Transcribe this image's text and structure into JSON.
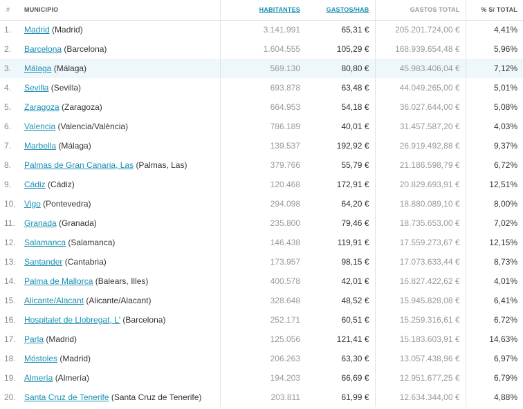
{
  "headers": {
    "num": "#",
    "municipio": "MUNICIPIO",
    "habitantes": "HABITANTES",
    "gastos_hab": "GASTOS/HAB",
    "gastos_total": "GASTOS TOTAL",
    "pct_total": "% S/ TOTAL"
  },
  "highlight_color": "#eef7f9",
  "link_color": "#1a8fb3",
  "rows": [
    {
      "num": "1.",
      "name": "Madrid",
      "province": "(Madrid)",
      "habitantes": "3.141.991",
      "gastos_hab": "65,31 €",
      "gastos_total": "205.201.724,00 €",
      "pct": "4,41%"
    },
    {
      "num": "2.",
      "name": "Barcelona",
      "province": "(Barcelona)",
      "habitantes": "1.604.555",
      "gastos_hab": "105,29 €",
      "gastos_total": "168.939.654,48 €",
      "pct": "5,96%"
    },
    {
      "num": "3.",
      "name": "Málaga",
      "province": "(Málaga)",
      "habitantes": "569.130",
      "gastos_hab": "80,80 €",
      "gastos_total": "45.983.406,04 €",
      "pct": "7,12%"
    },
    {
      "num": "4.",
      "name": "Sevilla",
      "province": "(Sevilla)",
      "habitantes": "693.878",
      "gastos_hab": "63,48 €",
      "gastos_total": "44.049.265,00 €",
      "pct": "5,01%"
    },
    {
      "num": "5.",
      "name": "Zaragoza",
      "province": "(Zaragoza)",
      "habitantes": "664.953",
      "gastos_hab": "54,18 €",
      "gastos_total": "36.027.644,00 €",
      "pct": "5,08%"
    },
    {
      "num": "6.",
      "name": "Valencia",
      "province": "(Valencia/València)",
      "habitantes": "786.189",
      "gastos_hab": "40,01 €",
      "gastos_total": "31.457.587,20 €",
      "pct": "4,03%"
    },
    {
      "num": "7.",
      "name": "Marbella",
      "province": "(Málaga)",
      "habitantes": "139.537",
      "gastos_hab": "192,92 €",
      "gastos_total": "26.919.492,88 €",
      "pct": "9,37%"
    },
    {
      "num": "8.",
      "name": "Palmas de Gran Canaria, Las",
      "province": "(Palmas, Las)",
      "habitantes": "379.766",
      "gastos_hab": "55,79 €",
      "gastos_total": "21.186.598,79 €",
      "pct": "6,72%"
    },
    {
      "num": "9.",
      "name": "Cádiz",
      "province": "(Cádiz)",
      "habitantes": "120.468",
      "gastos_hab": "172,91 €",
      "gastos_total": "20.829.693,91 €",
      "pct": "12,51%"
    },
    {
      "num": "10.",
      "name": "Vigo",
      "province": "(Pontevedra)",
      "habitantes": "294.098",
      "gastos_hab": "64,20 €",
      "gastos_total": "18.880.089,10 €",
      "pct": "8,00%"
    },
    {
      "num": "11.",
      "name": "Granada",
      "province": "(Granada)",
      "habitantes": "235.800",
      "gastos_hab": "79,46 €",
      "gastos_total": "18.735.653,00 €",
      "pct": "7,02%"
    },
    {
      "num": "12.",
      "name": "Salamanca",
      "province": "(Salamanca)",
      "habitantes": "146.438",
      "gastos_hab": "119,91 €",
      "gastos_total": "17.559.273,67 €",
      "pct": "12,15%"
    },
    {
      "num": "13.",
      "name": "Santander",
      "province": "(Cantabria)",
      "habitantes": "173.957",
      "gastos_hab": "98,15 €",
      "gastos_total": "17.073.633,44 €",
      "pct": "8,73%"
    },
    {
      "num": "14.",
      "name": "Palma de Mallorca",
      "province": "(Balears, Illes)",
      "habitantes": "400.578",
      "gastos_hab": "42,01 €",
      "gastos_total": "16.827.422,62 €",
      "pct": "4,01%"
    },
    {
      "num": "15.",
      "name": "Alicante/Alacant",
      "province": "(Alicante/Alacant)",
      "habitantes": "328.648",
      "gastos_hab": "48,52 €",
      "gastos_total": "15.945.828,08 €",
      "pct": "6,41%"
    },
    {
      "num": "16.",
      "name": "Hospitalet de Llobregat, L'",
      "province": "(Barcelona)",
      "habitantes": "252.171",
      "gastos_hab": "60,51 €",
      "gastos_total": "15.259.316,61 €",
      "pct": "6,72%"
    },
    {
      "num": "17.",
      "name": "Parla",
      "province": "(Madrid)",
      "habitantes": "125.056",
      "gastos_hab": "121,41 €",
      "gastos_total": "15.183.603,91 €",
      "pct": "14,63%"
    },
    {
      "num": "18.",
      "name": "Móstoles",
      "province": "(Madrid)",
      "habitantes": "206.263",
      "gastos_hab": "63,30 €",
      "gastos_total": "13.057.438,96 €",
      "pct": "6,97%"
    },
    {
      "num": "19.",
      "name": "Almería",
      "province": "(Almería)",
      "habitantes": "194.203",
      "gastos_hab": "66,69 €",
      "gastos_total": "12.951.677,25 €",
      "pct": "6,79%"
    },
    {
      "num": "20.",
      "name": "Santa Cruz de Tenerife",
      "province": "(Santa Cruz de Tenerife)",
      "habitantes": "203.811",
      "gastos_hab": "61,99 €",
      "gastos_total": "12.634.344,00 €",
      "pct": "4,88%"
    }
  ]
}
